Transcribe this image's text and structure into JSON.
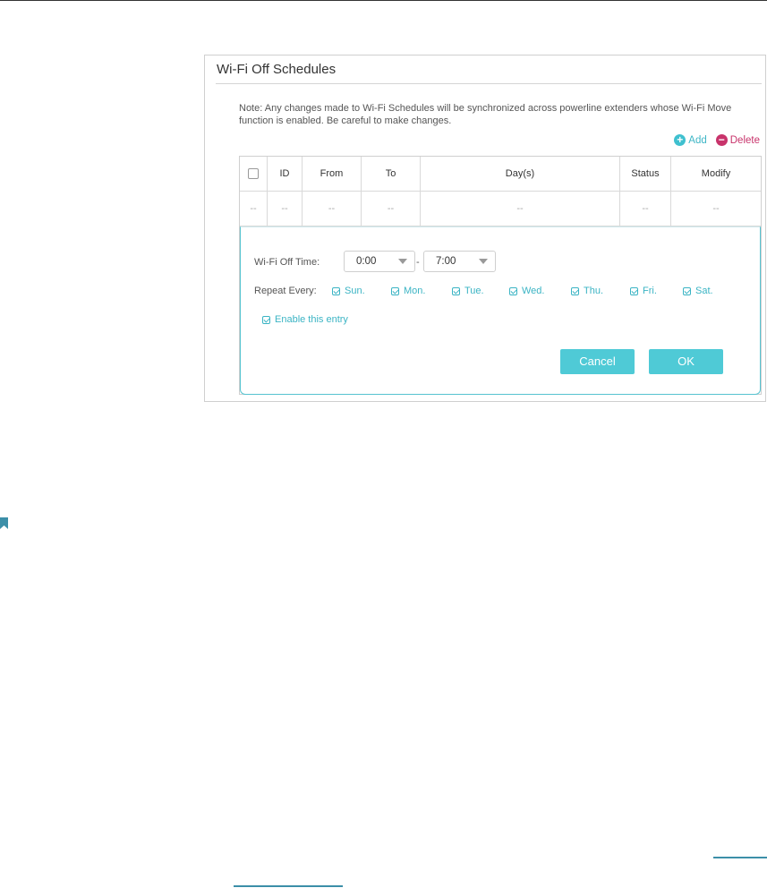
{
  "panel": {
    "title": "Wi-Fi Off Schedules",
    "note": "Note: Any changes made to Wi-Fi Schedules will be synchronized across powerline extenders whose Wi-Fi Move function is enabled. Be careful to make changes."
  },
  "actions": {
    "add_label": "Add",
    "delete_label": "Delete"
  },
  "table": {
    "headers": [
      "ID",
      "From",
      "To",
      "Day(s)",
      "Status",
      "Modify"
    ],
    "row": [
      "--",
      "--",
      "--",
      "--",
      "--",
      "--",
      "--"
    ]
  },
  "editor": {
    "off_time_label": "Wi-Fi Off Time:",
    "from_value": "0:00",
    "separator": "-",
    "to_value": "7:00",
    "repeat_label": "Repeat Every:",
    "days": [
      "Sun.",
      "Mon.",
      "Tue.",
      "Wed.",
      "Thu.",
      "Fri.",
      "Sat."
    ],
    "enable_label": "Enable this entry",
    "cancel_label": "Cancel",
    "ok_label": "OK"
  },
  "colors": {
    "accent": "#4fcad6",
    "delete": "#c8336b"
  }
}
